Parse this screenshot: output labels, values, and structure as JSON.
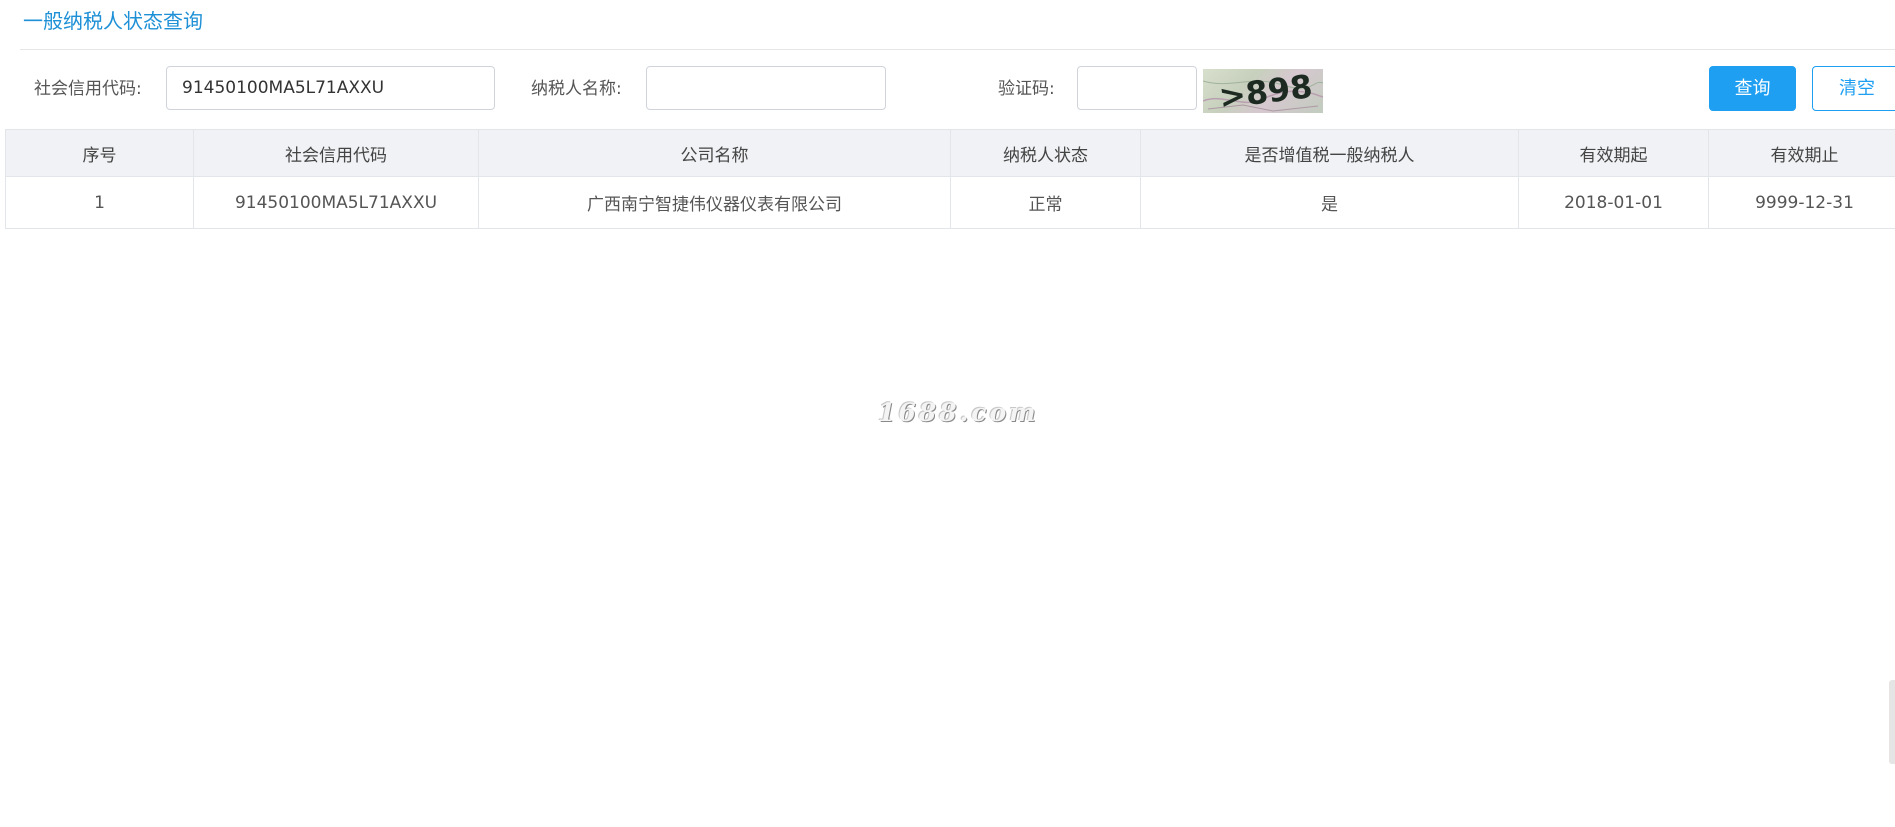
{
  "page": {
    "title": "一般纳税人状态查询"
  },
  "search": {
    "credit_code_label": "社会信用代码:",
    "credit_code_value": "91450100MA5L71AXXU",
    "taxpayer_name_label": "纳税人名称:",
    "taxpayer_name_value": "",
    "captcha_label": "验证码:",
    "captcha_value": "",
    "captcha_text": ">898",
    "query_button": "查询",
    "clear_button": "清空"
  },
  "table": {
    "columns": [
      "序号",
      "社会信用代码",
      "公司名称",
      "纳税人状态",
      "是否增值税一般纳税人",
      "有效期起",
      "有效期止"
    ],
    "rows": [
      [
        "1",
        "91450100MA5L71AXXU",
        "广西南宁智捷伟仪器仪表有限公司",
        "正常",
        "是",
        "2018-01-01",
        "9999-12-31"
      ]
    ]
  },
  "watermark": "1688.com",
  "colors": {
    "accent": "#1e9ff2",
    "title": "#1e90d6",
    "header_bg": "#f0f2f5",
    "border": "#e2e5ea"
  },
  "icons": {
    "captcha": "captcha-image"
  }
}
